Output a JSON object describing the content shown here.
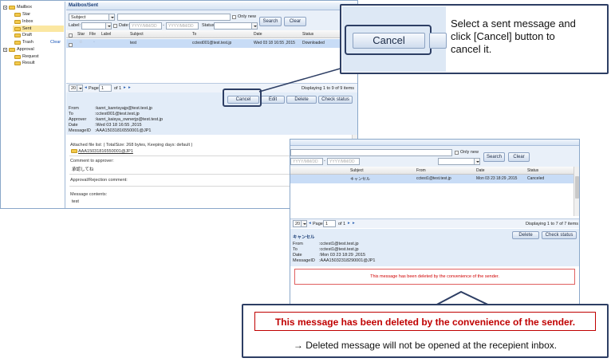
{
  "tree": {
    "items": [
      {
        "label": "Mailbox"
      },
      {
        "label": "Star"
      },
      {
        "label": "Inbox"
      },
      {
        "label": "Sent"
      },
      {
        "label": "Draft"
      },
      {
        "label": "Trash"
      },
      {
        "label": "Clear"
      },
      {
        "label": "Approval"
      },
      {
        "label": "Request"
      },
      {
        "label": "Result"
      }
    ]
  },
  "main": {
    "title": "Mailbox/Sent",
    "filter_field": "Subject",
    "only_new_label": "Only new",
    "label_label": "Label:",
    "date_label": "Date:",
    "date_from_placeholder": "YYYY/MM/DD",
    "date_to_placeholder": "YYYY/MM/DD",
    "status_label": "Status:",
    "search_label": "Search",
    "clear_label": "Clear",
    "columns": [
      "Star",
      "File",
      "Label",
      "Subject",
      "To",
      "Date",
      "Status"
    ],
    "row": {
      "subject": "test",
      "to": "cctest001@test.test.jp",
      "date": "Wed 03 18 16:55 ,2015",
      "status": "Downloaded"
    },
    "pager": {
      "per_page": "20",
      "page_label": "Page:",
      "page": "1",
      "of": "of 1",
      "display": "Displaying 1 to 9 of 9 items"
    },
    "actions": {
      "cancel": "Cancel",
      "edit": "Edit",
      "delete": "Delete",
      "check_status": "Check status"
    },
    "details": [
      {
        "k": "From",
        "v": ":kanri_kanrisyajp@test.test.jp"
      },
      {
        "k": "To",
        "v": ":cctest001@test.test.jp"
      },
      {
        "k": "Approver",
        "v": ":kanri_kaisya_ownerjp@test.test.jp"
      },
      {
        "k": "Date",
        "v": ":Wed 03 18 16:55 ,2015"
      },
      {
        "k": "MessageID",
        "v": ":AAA15031816550001@JP1"
      }
    ],
    "attached_title": "Attached file list: ( TotalSize: 268 bytes, Keeping days: default )",
    "attached_file": "AAA15031816550001@JP1",
    "comment_title": "Comment to approver:",
    "comment_text": "承認してね",
    "rejection_title": "Approval/Rejection comment:",
    "contents_title": "Message contents:",
    "contents_text": "test"
  },
  "zoom": {
    "cancel_label": "Cancel",
    "text": "Select a sent message and click [Cancel] button to cancel it."
  },
  "second": {
    "only_new_label": "Only new",
    "date_from_placeholder": "YYYY/MM/DD",
    "date_to_placeholder": "YYYY/MM/DD",
    "search_label": "Search",
    "clear_label": "Clear",
    "columns": [
      "Subject",
      "From",
      "Date",
      "Status"
    ],
    "row": {
      "subject": "キャンセル",
      "from": "cctest1@test.test.jp",
      "date": "Mon 03 23 18:29 ,2015",
      "status": "Canceled"
    },
    "pager": {
      "per_page": "20",
      "page_label": "Page:",
      "page": "1",
      "of": "of 1",
      "display": "Displaying 1 to 7 of 7 items"
    },
    "msg_title": "キャンセル",
    "actions": {
      "delete": "Delete",
      "check_status": "Check status"
    },
    "details": [
      {
        "k": "From",
        "v": ":cctest1@test.test.jp"
      },
      {
        "k": "To",
        "v": ":cctest1@test.test.jp"
      },
      {
        "k": "Date",
        "v": ":Mon 03 23 18:29 ,2015"
      },
      {
        "k": "MessageID",
        "v": ":AAA15032318290001@JP1"
      }
    ],
    "deleted_notice": "This message has been deleted by the convenience of the sender."
  },
  "note": {
    "headline": "This message has been deleted by the convenience of the sender.",
    "text": "→ Deleted message will not be opened at the recepient inbox."
  },
  "colors": {
    "accent": "#2d3e64",
    "alert": "#c00000",
    "selection": "#c8dcf6"
  }
}
